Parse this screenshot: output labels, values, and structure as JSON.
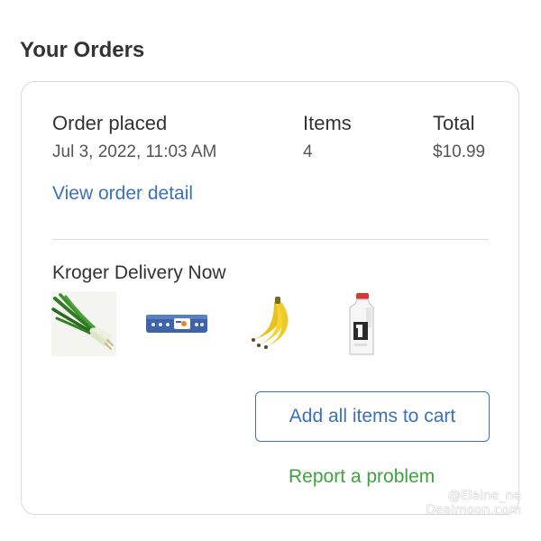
{
  "page": {
    "title": "Your Orders"
  },
  "order": {
    "placed_label": "Order placed",
    "placed_value": "Jul 3, 2022, 11:03 AM",
    "items_label": "Items",
    "items_value": "4",
    "total_label": "Total",
    "total_value": "$10.99",
    "detail_link": "View order detail",
    "store": "Kroger Delivery Now",
    "products": [
      {
        "icon": "green-onions-icon"
      },
      {
        "icon": "egg-carton-icon"
      },
      {
        "icon": "bananas-icon"
      },
      {
        "icon": "milk-jug-icon"
      }
    ],
    "add_to_cart_label": "Add all items to cart",
    "report_label": "Report a problem"
  },
  "watermark": {
    "line1": "@Elaine_ne",
    "line2": "Dealmoon.com"
  },
  "colors": {
    "link": "#3b72b8",
    "report": "#3ea33e",
    "border": "#d9d9d9"
  }
}
